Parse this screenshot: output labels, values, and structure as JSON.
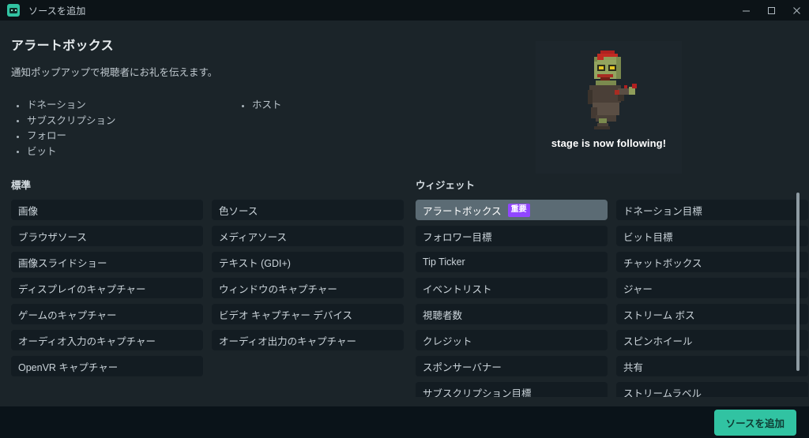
{
  "titlebar": {
    "app_icon": "streamlabs-app-icon",
    "title": "ソースを追加",
    "minimize_label": "最小化",
    "maximize_label": "最大化",
    "close_label": "閉じる"
  },
  "header": {
    "title": "アラートボックス",
    "subtitle": "通知ポップアップで視聴者にお礼を伝えます。",
    "features_col1": [
      "ドネーション",
      "サブスクリプション",
      "フォロー",
      "ビット"
    ],
    "features_col2": [
      "ホスト"
    ]
  },
  "preview": {
    "sprite_name": "zombie-pixel-sprite",
    "caption": "stage is now following!"
  },
  "standard": {
    "title": "標準",
    "items": [
      "画像",
      "色ソース",
      "ブラウザソース",
      "メディアソース",
      "画像スライドショー",
      "テキスト (GDI+)",
      "ディスプレイのキャプチャー",
      "ウィンドウのキャプチャー",
      "ゲームのキャプチャー",
      "ビデオ キャプチャー デバイス",
      "オーディオ入力のキャプチャー",
      "オーディオ出力のキャプチャー",
      "OpenVR キャプチャー"
    ]
  },
  "widgets": {
    "title": "ウィジェット",
    "items": [
      {
        "label": "アラートボックス",
        "badge": "重要",
        "selected": true
      },
      {
        "label": "ドネーション目標",
        "badge": "",
        "selected": false
      },
      {
        "label": "フォロワー目標",
        "badge": "",
        "selected": false
      },
      {
        "label": "ビット目標",
        "badge": "",
        "selected": false
      },
      {
        "label": "Tip Ticker",
        "badge": "",
        "selected": false
      },
      {
        "label": "チャットボックス",
        "badge": "",
        "selected": false
      },
      {
        "label": "イベントリスト",
        "badge": "",
        "selected": false
      },
      {
        "label": "ジャー",
        "badge": "",
        "selected": false
      },
      {
        "label": "視聴者数",
        "badge": "",
        "selected": false
      },
      {
        "label": "ストリーム ボス",
        "badge": "",
        "selected": false
      },
      {
        "label": "クレジット",
        "badge": "",
        "selected": false
      },
      {
        "label": "スピンホイール",
        "badge": "",
        "selected": false
      },
      {
        "label": "スポンサーバナー",
        "badge": "",
        "selected": false
      },
      {
        "label": "共有",
        "badge": "",
        "selected": false
      },
      {
        "label": "サブスクリプション目標",
        "badge": "",
        "selected": false
      },
      {
        "label": "ストリームラベル",
        "badge": "",
        "selected": false
      }
    ]
  },
  "footer": {
    "add_source_label": "ソースを追加"
  },
  "colors": {
    "window_bg": "#1b2429",
    "titlebar_bg": "#0c1317",
    "footer_bg": "#0a1319",
    "tile_bg": "#131c22",
    "tile_selected_bg": "#5b6b74",
    "badge_bg": "#9146ff",
    "accent": "#31c3a2",
    "scrollbar_thumb": "#8e9ba3"
  }
}
